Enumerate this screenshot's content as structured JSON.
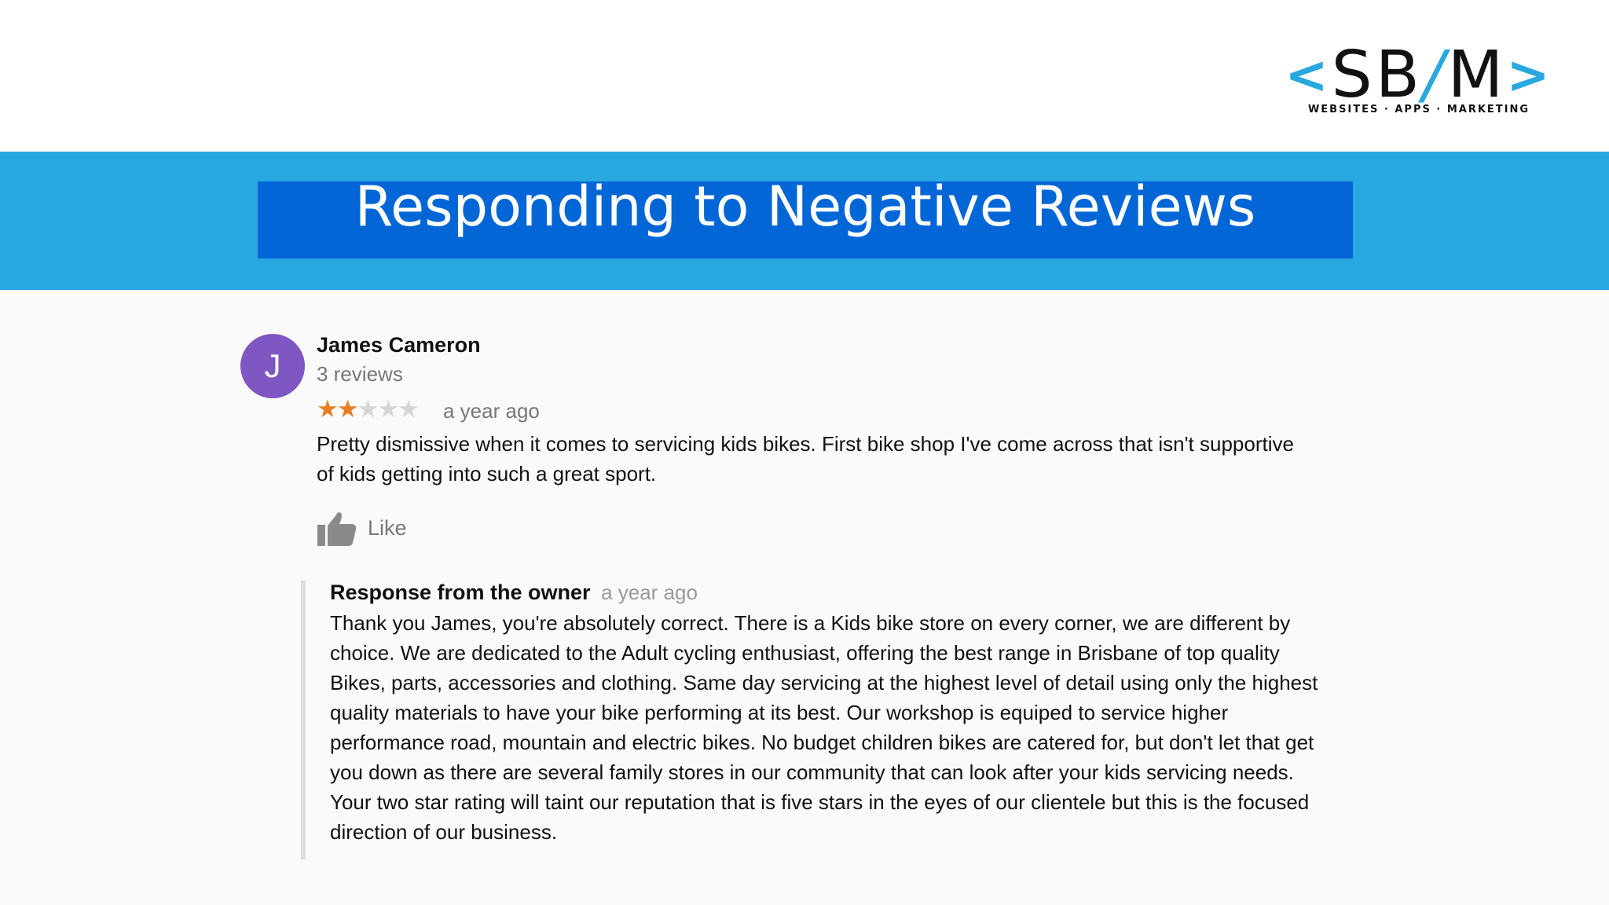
{
  "logo": {
    "left_chevron": "<",
    "letters_sb": "SB",
    "slash": "/",
    "letter_m": "M",
    "right_chevron": ">",
    "tagline": "WEBSITES · APPS · MARKETING",
    "accent_color": "#29a8e0"
  },
  "banner": {
    "title": "Responding to Negative Reviews",
    "background_color": "#29a8e0",
    "title_box_color": "#0366d6"
  },
  "review": {
    "avatar_initial": "J",
    "avatar_color": "#7e57c2",
    "reviewer_name": "James Cameron",
    "reviewer_count": "3 reviews",
    "rating": 2,
    "rating_max": 5,
    "star_filled": "★★",
    "star_empty": "★★★",
    "star_color": "#e67e22",
    "time": "a year ago",
    "text": "Pretty dismissive when it comes to servicing kids bikes.  First bike shop I've come across that isn't supportive of kids getting into such a great sport.",
    "like_icon": "thumbs-up-icon",
    "like_label": "Like"
  },
  "owner_response": {
    "title": "Response from the owner",
    "time": "a year ago",
    "text": "Thank you James, you're absolutely correct. There is a Kids bike store on every corner, we are different by choice. We are dedicated to the Adult cycling enthusiast, offering the best range in Brisbane of top quality Bikes, parts, accessories and clothing. Same day servicing at the highest level of detail using only the highest quality materials to have your bike performing at its best. Our workshop is equiped to service higher performance road, mountain and electric bikes. No budget children bikes are catered for, but don't let that get you down as there are several family stores in our community that can look after your kids servicing needs. Your two star rating will taint our reputation that is five stars in the eyes of our clientele but this is the focused direction of our business."
  }
}
